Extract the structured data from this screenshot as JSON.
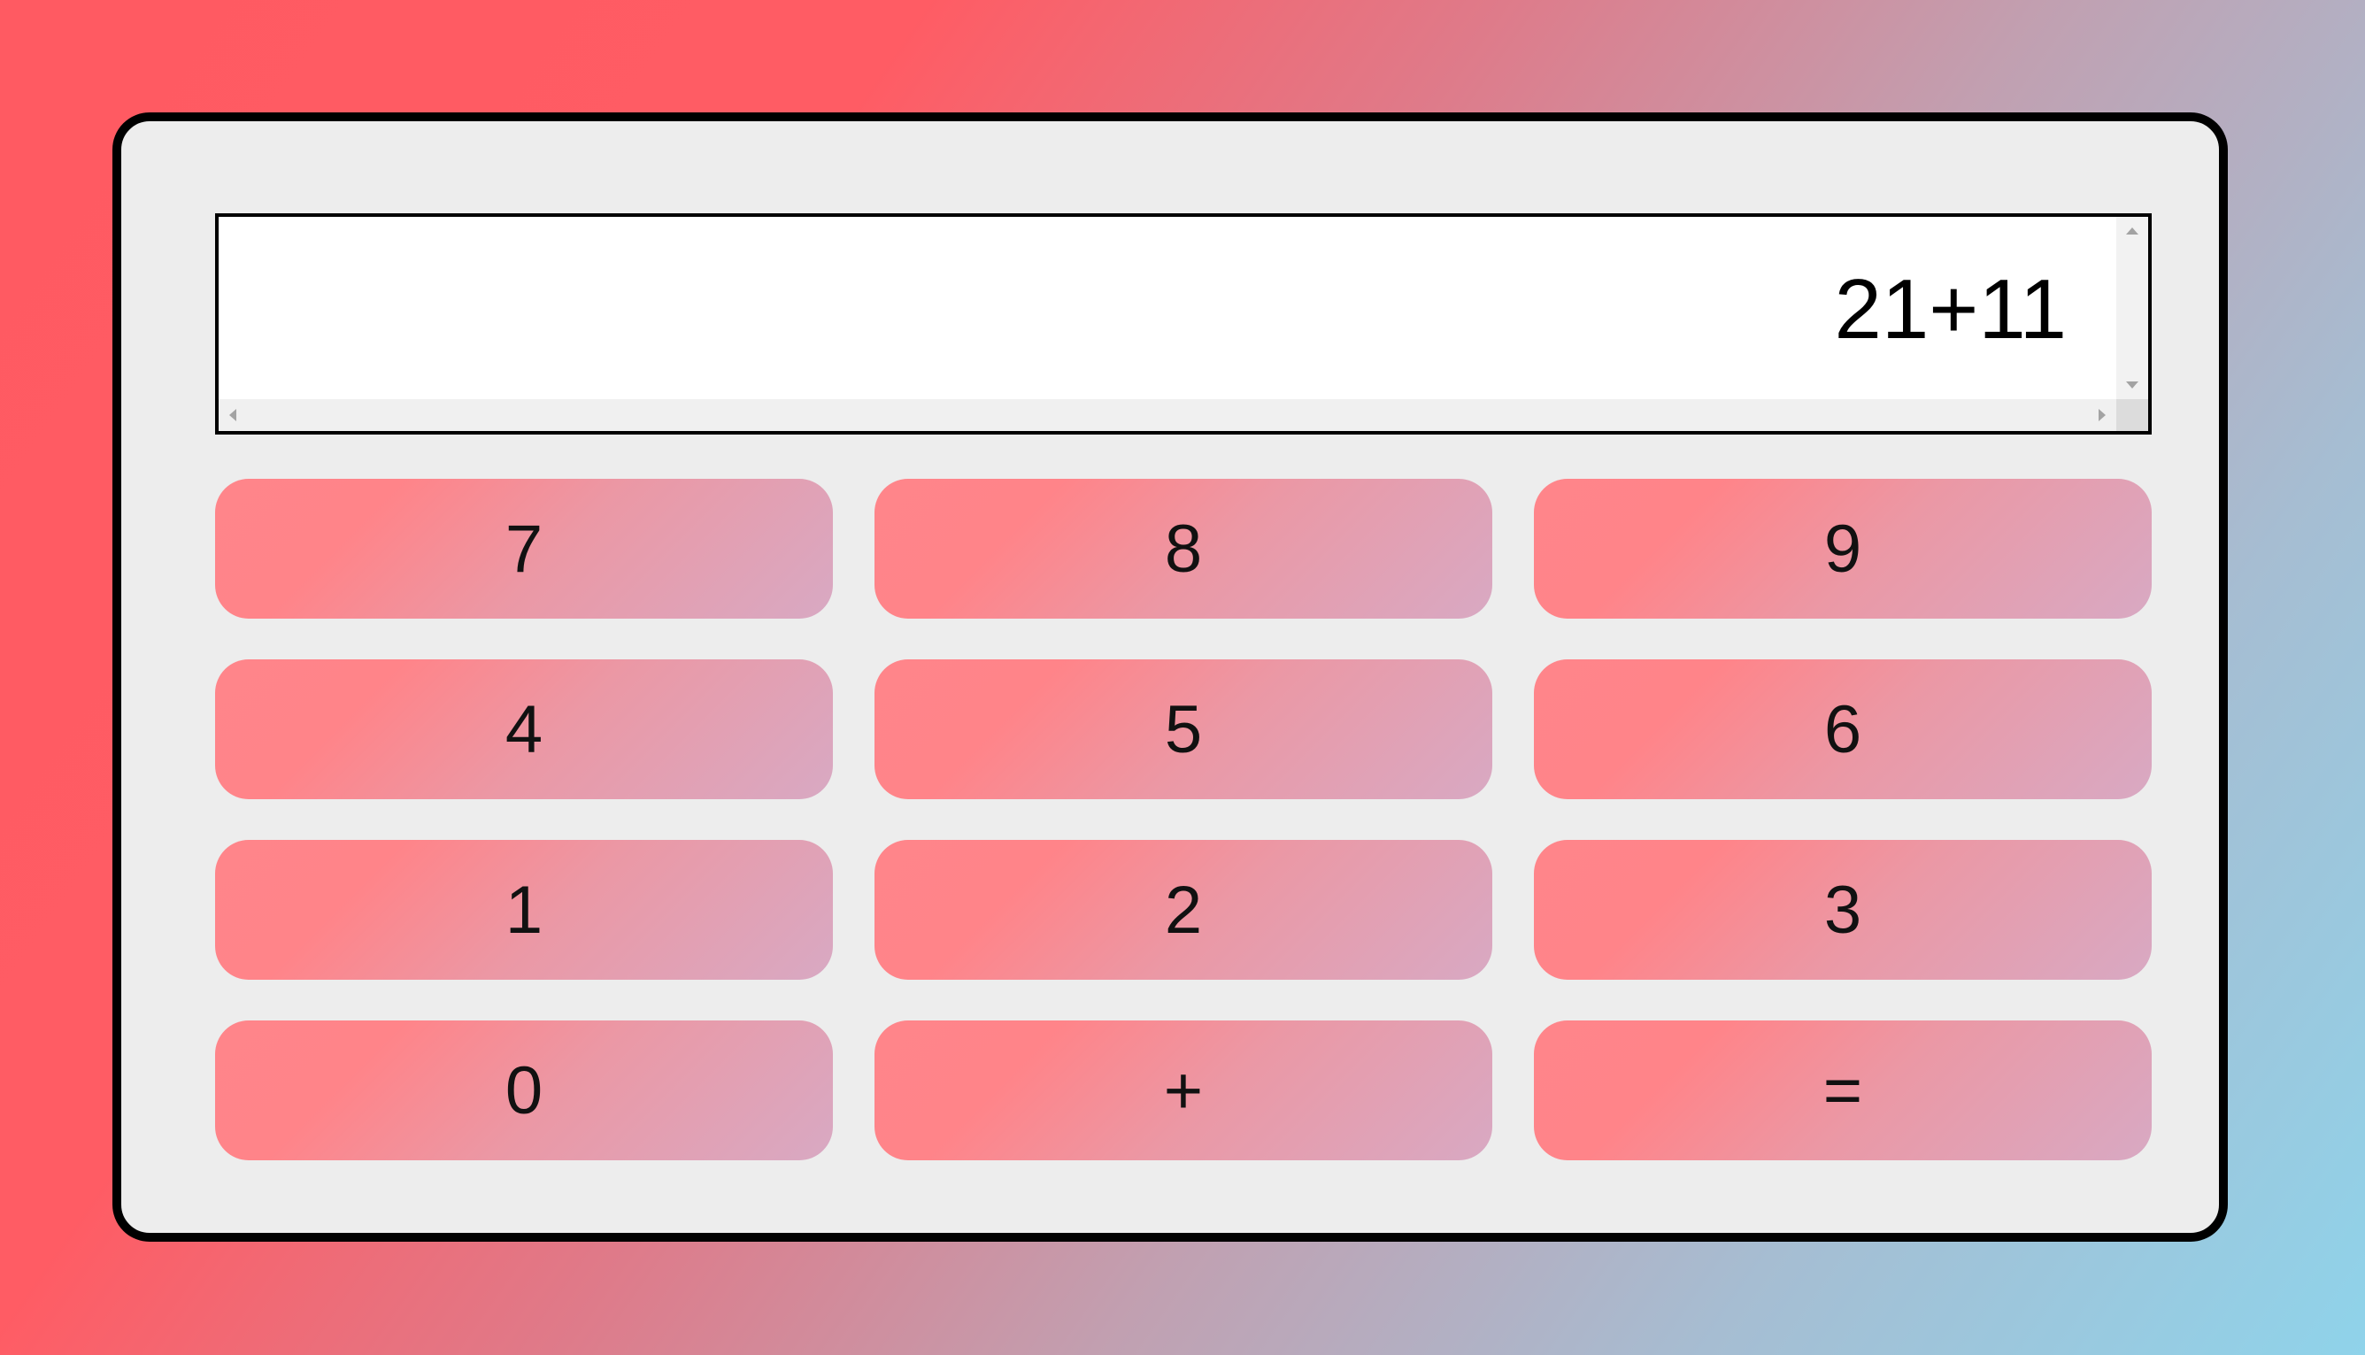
{
  "display": {
    "expression": "21+11"
  },
  "keys": [
    {
      "label": "7",
      "name": "key-7"
    },
    {
      "label": "8",
      "name": "key-8"
    },
    {
      "label": "9",
      "name": "key-9"
    },
    {
      "label": "4",
      "name": "key-4"
    },
    {
      "label": "5",
      "name": "key-5"
    },
    {
      "label": "6",
      "name": "key-6"
    },
    {
      "label": "1",
      "name": "key-1"
    },
    {
      "label": "2",
      "name": "key-2"
    },
    {
      "label": "3",
      "name": "key-3"
    },
    {
      "label": "0",
      "name": "key-0"
    },
    {
      "label": "+",
      "name": "key-plus"
    },
    {
      "label": "=",
      "name": "key-equals"
    }
  ],
  "colors": {
    "background_start": "#ff5a62",
    "background_end": "#8fd3ea",
    "card_background": "#ededed",
    "key_start": "#ff858a",
    "key_end": "#d8a9c3"
  }
}
